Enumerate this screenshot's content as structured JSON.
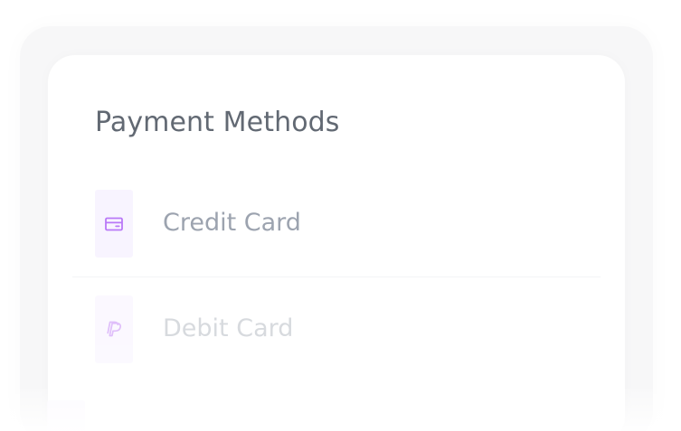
{
  "payment_methods": {
    "title": "Payment Methods",
    "items": [
      {
        "label": "Credit Card",
        "icon": "credit-card-icon"
      },
      {
        "label": "Debit Card",
        "icon": "paypal-icon"
      }
    ]
  },
  "colors": {
    "title": "#626973",
    "label": "#9ca3af",
    "accent": "#a855f7",
    "icon_tile_background": "#f8f4ff",
    "panel_background": "#f7f7f8",
    "card_background": "#ffffff"
  }
}
